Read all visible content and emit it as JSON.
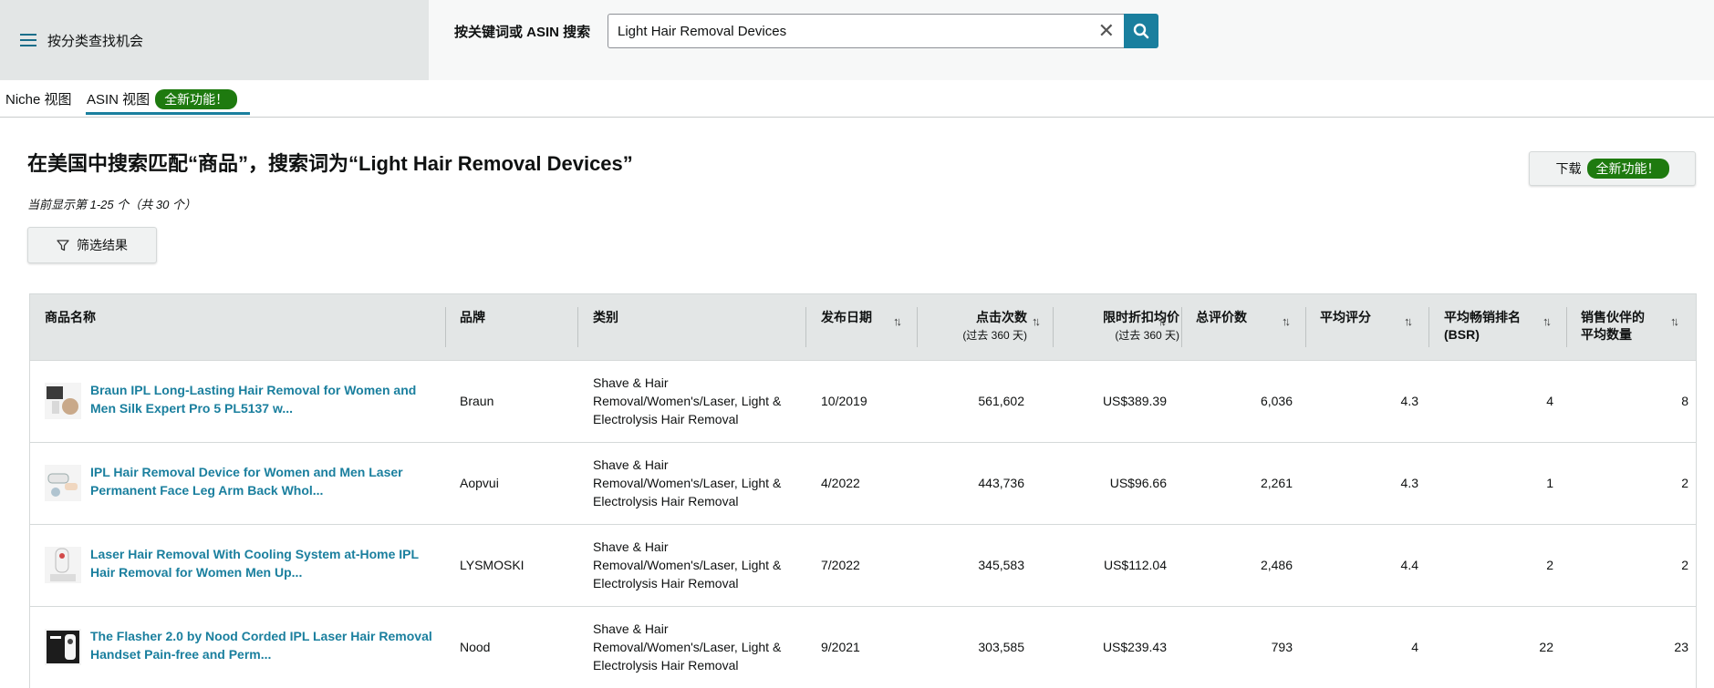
{
  "header": {
    "category_label": "按分类查找机会",
    "search_label": "按关键词或 ASIN 搜索",
    "search_value": "Light Hair Removal Devices"
  },
  "tabs": {
    "niche": "Niche 视图",
    "asin": "ASIN 视图",
    "new_badge": "全新功能！"
  },
  "main": {
    "title": "在美国中搜索匹配“商品”，搜索词为“Light Hair Removal Devices”",
    "count": "当前显示第 1-25 个（共 30 个）",
    "download_label": "下载",
    "download_badge": "全新功能！",
    "filter_label": "筛选结果"
  },
  "table": {
    "headers": {
      "name": "商品名称",
      "brand": "品牌",
      "category": "类别",
      "date": "发布日期",
      "clicks": "点击次数",
      "clicks_sub": "(过去 360 天)",
      "price": "限时折扣均价",
      "price_sub": "(过去 360 天)",
      "reviews": "总评价数",
      "rating": "平均评分",
      "bsr_1": "平均畅销排名",
      "bsr_2": "(BSR)",
      "sellers_1": "销售伙伴的",
      "sellers_2": "平均数量"
    },
    "rows": [
      {
        "name": "Braun IPL Long-Lasting Hair Removal for Women and Men Silk Expert Pro 5 PL5137 w...",
        "brand": "Braun",
        "category": "Shave & Hair Removal/Women's/Laser, Light & Electrolysis Hair Removal",
        "date": "10/2019",
        "clicks": "561,602",
        "price": "US$389.39",
        "reviews": "6,036",
        "rating": "4.3",
        "bsr": "4",
        "sellers": "8"
      },
      {
        "name": "IPL Hair Removal Device for Women and Men Laser Permanent Face Leg Arm Back Whol...",
        "brand": "Aopvui",
        "category": "Shave & Hair Removal/Women's/Laser, Light & Electrolysis Hair Removal",
        "date": "4/2022",
        "clicks": "443,736",
        "price": "US$96.66",
        "reviews": "2,261",
        "rating": "4.3",
        "bsr": "1",
        "sellers": "2"
      },
      {
        "name": "Laser Hair Removal With Cooling System at-Home IPL Hair Removal for Women Men Up...",
        "brand": "LYSMOSKI",
        "category": "Shave & Hair Removal/Women's/Laser, Light & Electrolysis Hair Removal",
        "date": "7/2022",
        "clicks": "345,583",
        "price": "US$112.04",
        "reviews": "2,486",
        "rating": "4.4",
        "bsr": "2",
        "sellers": "2"
      },
      {
        "name": "The Flasher 2.0 by Nood Corded IPL Laser Hair Removal Handset Pain-free and Perm...",
        "brand": "Nood",
        "category": "Shave & Hair Removal/Women's/Laser, Light & Electrolysis Hair Removal",
        "date": "9/2021",
        "clicks": "303,585",
        "price": "US$239.43",
        "reviews": "793",
        "rating": "4",
        "bsr": "22",
        "sellers": "23"
      }
    ]
  },
  "colors": {
    "accent": "#1a7f9e",
    "badge": "#1e7a0f",
    "header_bg": "#e3e6e6"
  }
}
